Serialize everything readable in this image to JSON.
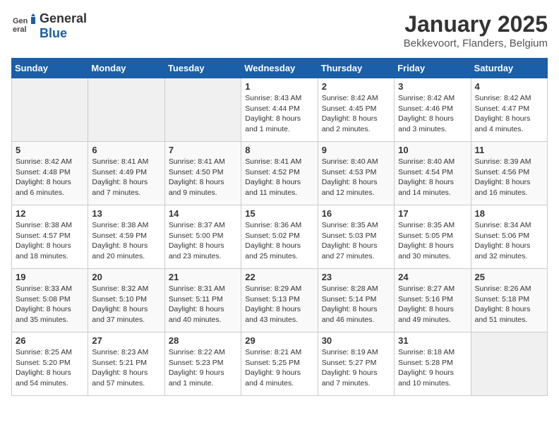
{
  "header": {
    "logo_general": "General",
    "logo_blue": "Blue",
    "month_year": "January 2025",
    "location": "Bekkevoort, Flanders, Belgium"
  },
  "days_of_week": [
    "Sunday",
    "Monday",
    "Tuesday",
    "Wednesday",
    "Thursday",
    "Friday",
    "Saturday"
  ],
  "weeks": [
    [
      {
        "day": "",
        "info": ""
      },
      {
        "day": "",
        "info": ""
      },
      {
        "day": "",
        "info": ""
      },
      {
        "day": "1",
        "info": "Sunrise: 8:43 AM\nSunset: 4:44 PM\nDaylight: 8 hours\nand 1 minute."
      },
      {
        "day": "2",
        "info": "Sunrise: 8:42 AM\nSunset: 4:45 PM\nDaylight: 8 hours\nand 2 minutes."
      },
      {
        "day": "3",
        "info": "Sunrise: 8:42 AM\nSunset: 4:46 PM\nDaylight: 8 hours\nand 3 minutes."
      },
      {
        "day": "4",
        "info": "Sunrise: 8:42 AM\nSunset: 4:47 PM\nDaylight: 8 hours\nand 4 minutes."
      }
    ],
    [
      {
        "day": "5",
        "info": "Sunrise: 8:42 AM\nSunset: 4:48 PM\nDaylight: 8 hours\nand 6 minutes."
      },
      {
        "day": "6",
        "info": "Sunrise: 8:41 AM\nSunset: 4:49 PM\nDaylight: 8 hours\nand 7 minutes."
      },
      {
        "day": "7",
        "info": "Sunrise: 8:41 AM\nSunset: 4:50 PM\nDaylight: 8 hours\nand 9 minutes."
      },
      {
        "day": "8",
        "info": "Sunrise: 8:41 AM\nSunset: 4:52 PM\nDaylight: 8 hours\nand 11 minutes."
      },
      {
        "day": "9",
        "info": "Sunrise: 8:40 AM\nSunset: 4:53 PM\nDaylight: 8 hours\nand 12 minutes."
      },
      {
        "day": "10",
        "info": "Sunrise: 8:40 AM\nSunset: 4:54 PM\nDaylight: 8 hours\nand 14 minutes."
      },
      {
        "day": "11",
        "info": "Sunrise: 8:39 AM\nSunset: 4:56 PM\nDaylight: 8 hours\nand 16 minutes."
      }
    ],
    [
      {
        "day": "12",
        "info": "Sunrise: 8:38 AM\nSunset: 4:57 PM\nDaylight: 8 hours\nand 18 minutes."
      },
      {
        "day": "13",
        "info": "Sunrise: 8:38 AM\nSunset: 4:59 PM\nDaylight: 8 hours\nand 20 minutes."
      },
      {
        "day": "14",
        "info": "Sunrise: 8:37 AM\nSunset: 5:00 PM\nDaylight: 8 hours\nand 23 minutes."
      },
      {
        "day": "15",
        "info": "Sunrise: 8:36 AM\nSunset: 5:02 PM\nDaylight: 8 hours\nand 25 minutes."
      },
      {
        "day": "16",
        "info": "Sunrise: 8:35 AM\nSunset: 5:03 PM\nDaylight: 8 hours\nand 27 minutes."
      },
      {
        "day": "17",
        "info": "Sunrise: 8:35 AM\nSunset: 5:05 PM\nDaylight: 8 hours\nand 30 minutes."
      },
      {
        "day": "18",
        "info": "Sunrise: 8:34 AM\nSunset: 5:06 PM\nDaylight: 8 hours\nand 32 minutes."
      }
    ],
    [
      {
        "day": "19",
        "info": "Sunrise: 8:33 AM\nSunset: 5:08 PM\nDaylight: 8 hours\nand 35 minutes."
      },
      {
        "day": "20",
        "info": "Sunrise: 8:32 AM\nSunset: 5:10 PM\nDaylight: 8 hours\nand 37 minutes."
      },
      {
        "day": "21",
        "info": "Sunrise: 8:31 AM\nSunset: 5:11 PM\nDaylight: 8 hours\nand 40 minutes."
      },
      {
        "day": "22",
        "info": "Sunrise: 8:29 AM\nSunset: 5:13 PM\nDaylight: 8 hours\nand 43 minutes."
      },
      {
        "day": "23",
        "info": "Sunrise: 8:28 AM\nSunset: 5:14 PM\nDaylight: 8 hours\nand 46 minutes."
      },
      {
        "day": "24",
        "info": "Sunrise: 8:27 AM\nSunset: 5:16 PM\nDaylight: 8 hours\nand 49 minutes."
      },
      {
        "day": "25",
        "info": "Sunrise: 8:26 AM\nSunset: 5:18 PM\nDaylight: 8 hours\nand 51 minutes."
      }
    ],
    [
      {
        "day": "26",
        "info": "Sunrise: 8:25 AM\nSunset: 5:20 PM\nDaylight: 8 hours\nand 54 minutes."
      },
      {
        "day": "27",
        "info": "Sunrise: 8:23 AM\nSunset: 5:21 PM\nDaylight: 8 hours\nand 57 minutes."
      },
      {
        "day": "28",
        "info": "Sunrise: 8:22 AM\nSunset: 5:23 PM\nDaylight: 9 hours\nand 1 minute."
      },
      {
        "day": "29",
        "info": "Sunrise: 8:21 AM\nSunset: 5:25 PM\nDaylight: 9 hours\nand 4 minutes."
      },
      {
        "day": "30",
        "info": "Sunrise: 8:19 AM\nSunset: 5:27 PM\nDaylight: 9 hours\nand 7 minutes."
      },
      {
        "day": "31",
        "info": "Sunrise: 8:18 AM\nSunset: 5:28 PM\nDaylight: 9 hours\nand 10 minutes."
      },
      {
        "day": "",
        "info": ""
      }
    ]
  ]
}
